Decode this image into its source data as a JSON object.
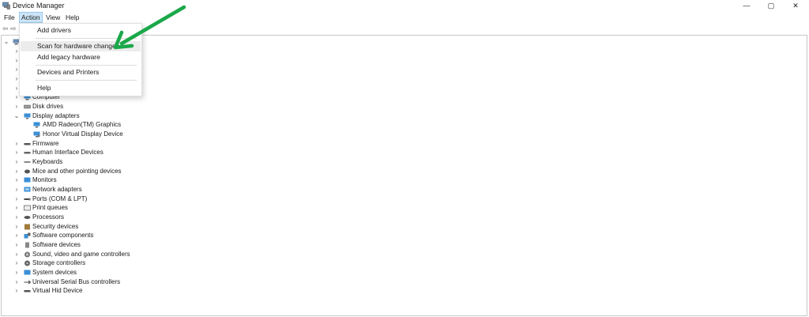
{
  "window": {
    "title": "Device Manager",
    "controls": [
      "—",
      "▢",
      "✕"
    ]
  },
  "menubar": {
    "items": [
      "File",
      "Action",
      "View",
      "Help"
    ]
  },
  "toolbar": {
    "back_icon": "back-arrow-icon",
    "forward_icon": "forward-arrow-icon"
  },
  "action_menu": {
    "items": [
      "Add drivers",
      "Scan for hardware changes",
      "Add legacy hardware",
      "Devices and Printers",
      "Help"
    ],
    "highlighted": "Scan for hardware changes"
  },
  "tree": {
    "nodes": [
      {
        "label": "Computer",
        "expanded": false
      },
      {
        "label": "Disk drives",
        "expanded": false
      },
      {
        "label": "Display adapters",
        "expanded": true
      },
      {
        "label": "AMD Radeon(TM) Graphics",
        "child": true
      },
      {
        "label": "Honor Virtual Display Device",
        "child": true
      },
      {
        "label": "Firmware",
        "expanded": false
      },
      {
        "label": "Human Interface Devices",
        "expanded": false
      },
      {
        "label": "Keyboards",
        "expanded": false
      },
      {
        "label": "Mice and other pointing devices",
        "expanded": false
      },
      {
        "label": "Monitors",
        "expanded": false
      },
      {
        "label": "Network adapters",
        "expanded": false
      },
      {
        "label": "Ports (COM & LPT)",
        "expanded": false
      },
      {
        "label": "Print queues",
        "expanded": false
      },
      {
        "label": "Processors",
        "expanded": false
      },
      {
        "label": "Security devices",
        "expanded": false
      },
      {
        "label": "Software components",
        "expanded": false
      },
      {
        "label": "Software devices",
        "expanded": false
      },
      {
        "label": "Sound, video and game controllers",
        "expanded": false
      },
      {
        "label": "Storage controllers",
        "expanded": false
      },
      {
        "label": "System devices",
        "expanded": false
      },
      {
        "label": "Universal Serial Bus controllers",
        "expanded": false
      },
      {
        "label": "Virtual Hid Device",
        "expanded": false
      }
    ]
  },
  "colors": {
    "annotation_arrow": "#1aa84a",
    "menu_active": "#cce4f7",
    "icon_blue": "#3a8fd6"
  }
}
